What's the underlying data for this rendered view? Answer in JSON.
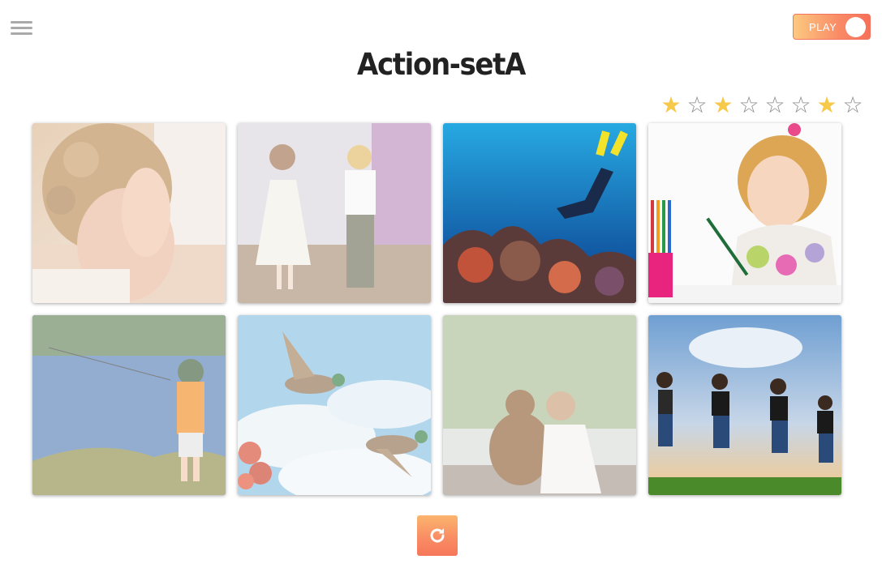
{
  "header": {
    "menu_icon": "hamburger-menu-icon",
    "play_toggle": {
      "label": "PLAY",
      "on": false,
      "colors": {
        "start": "#fcc980",
        "end": "#f67058"
      }
    },
    "title": "Action-setA"
  },
  "rating": {
    "star_colors": {
      "filled": "#f6c94a",
      "empty": "#8a8a8a"
    },
    "stars": [
      {
        "filled": true,
        "glyph": "★"
      },
      {
        "filled": false,
        "glyph": "☆"
      },
      {
        "filled": true,
        "glyph": "★"
      },
      {
        "filled": false,
        "glyph": "☆"
      },
      {
        "filled": false,
        "glyph": "☆"
      },
      {
        "filled": false,
        "glyph": "☆"
      },
      {
        "filled": true,
        "glyph": "★"
      },
      {
        "filled": false,
        "glyph": "☆"
      }
    ]
  },
  "grid": {
    "tiles": [
      {
        "subject": "child covering face (crying)",
        "faded": true
      },
      {
        "subject": "two children dancing",
        "faded": true
      },
      {
        "subject": "scuba diver over coral reef",
        "faded": false
      },
      {
        "subject": "girl drawing with pencils",
        "faded": false
      },
      {
        "subject": "boy fishing at lake",
        "faded": true
      },
      {
        "subject": "ducks flying in sky",
        "faded": true
      },
      {
        "subject": "girl hugging teddy bear",
        "faded": true
      },
      {
        "subject": "children jumping in field",
        "faded": false
      }
    ]
  },
  "footer": {
    "refresh_icon": "refresh-icon",
    "accent_color": "#f98d64"
  }
}
